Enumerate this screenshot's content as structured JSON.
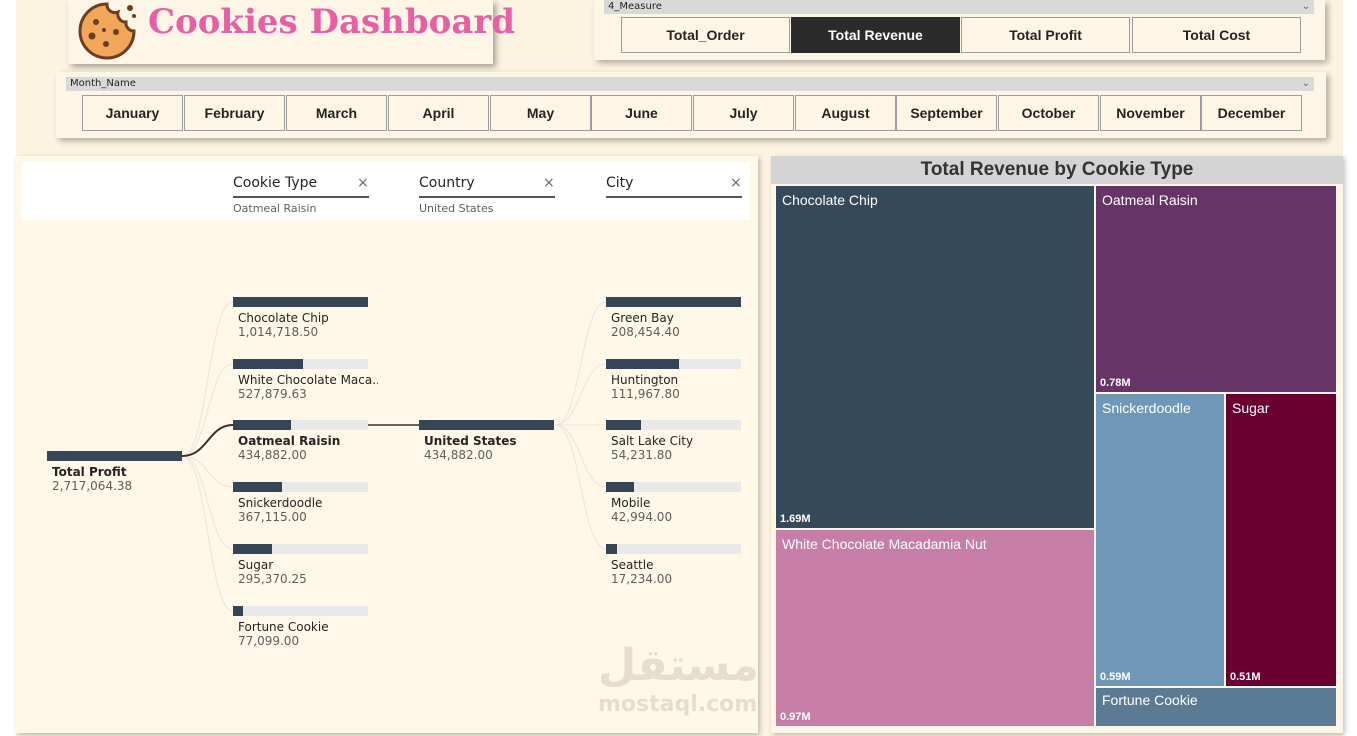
{
  "header": {
    "title": "Cookies Dashboard",
    "logo_icon": "cookie-icon"
  },
  "measure_slicer": {
    "field": "4_Measure",
    "options": [
      "Total_Order",
      "Total Revenue",
      "Total Profit",
      "Total Cost"
    ],
    "selected": "Total Revenue"
  },
  "month_slicer": {
    "field": "Month_Name",
    "options": [
      "January",
      "February",
      "March",
      "April",
      "May",
      "June",
      "July",
      "August",
      "September",
      "October",
      "November",
      "December"
    ]
  },
  "decomposition": {
    "levels": [
      {
        "title": "Cookie Type",
        "selected": "Oatmeal Raisin"
      },
      {
        "title": "Country",
        "selected": "United States"
      },
      {
        "title": "City",
        "selected": ""
      }
    ],
    "root": {
      "label": "Total Profit",
      "value": "2,717,064.38"
    },
    "cookie_types": [
      {
        "label": "Chocolate Chip",
        "value": "1,014,718.50",
        "fraction": 1.0
      },
      {
        "label": "White Chocolate Maca...",
        "value": "527,879.63",
        "fraction": 0.52
      },
      {
        "label": "Oatmeal Raisin",
        "value": "434,882.00",
        "fraction": 0.43,
        "selected": true
      },
      {
        "label": "Snickerdoodle",
        "value": "367,115.00",
        "fraction": 0.36
      },
      {
        "label": "Sugar",
        "value": "295,370.25",
        "fraction": 0.29
      },
      {
        "label": "Fortune Cookie",
        "value": "77,099.00",
        "fraction": 0.076
      }
    ],
    "country": {
      "label": "United States",
      "value": "434,882.00"
    },
    "cities": [
      {
        "label": "Green Bay",
        "value": "208,454.40",
        "fraction": 1.0
      },
      {
        "label": "Huntington",
        "value": "111,967.80",
        "fraction": 0.54
      },
      {
        "label": "Salt Lake City",
        "value": "54,231.80",
        "fraction": 0.26
      },
      {
        "label": "Mobile",
        "value": "42,994.00",
        "fraction": 0.21
      },
      {
        "label": "Seattle",
        "value": "17,234.00",
        "fraction": 0.083
      }
    ]
  },
  "treemap": {
    "title": "Total Revenue by Cookie Type",
    "tiles": [
      {
        "label": "Chocolate Chip",
        "value": "1.69M",
        "color": "#34495a"
      },
      {
        "label": "Oatmeal Raisin",
        "value": "0.78M",
        "color": "#673467"
      },
      {
        "label": "White Chocolate Macadamia Nut",
        "value": "0.97M",
        "color": "#c77ea6"
      },
      {
        "label": "Snickerdoodle",
        "value": "0.59M",
        "color": "#6f97b7"
      },
      {
        "label": "Sugar",
        "value": "0.51M",
        "color": "#6a0030"
      },
      {
        "label": "Fortune Cookie",
        "value": "",
        "color": "#5b7b95"
      }
    ]
  },
  "watermark": {
    "arabic": "مستقل",
    "latin": "mostaql.com"
  }
}
